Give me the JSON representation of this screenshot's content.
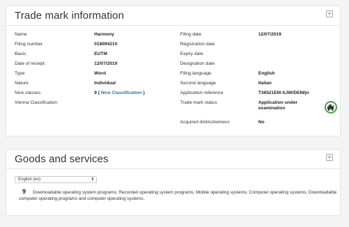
{
  "trade_mark": {
    "title": "Trade mark information",
    "expand_glyph": "+",
    "left_fields": [
      {
        "label": "Name",
        "value": "Harmony"
      },
      {
        "label": "Filing number",
        "value": "018094210"
      },
      {
        "label": "Basis",
        "value": "EUTM"
      },
      {
        "label": "Date of receipt",
        "value": "12/07/2019"
      },
      {
        "label": "Type",
        "value": "Word"
      },
      {
        "label": "Nature",
        "value": "Individual"
      },
      {
        "label": "Nice classes",
        "value_prefix": "9 ( ",
        "value_link": "Nice Classification",
        "value_suffix": " )"
      },
      {
        "label": "Vienna Classification",
        "value": ""
      }
    ],
    "right_fields": [
      {
        "label": "Filing date",
        "value": "12/07/2019"
      },
      {
        "label": "Registration date",
        "value": ""
      },
      {
        "label": "Expiry date",
        "value": ""
      },
      {
        "label": "Designation date",
        "value": ""
      },
      {
        "label": "Filing language",
        "value": "English"
      },
      {
        "label": "Second language",
        "value": "Italian"
      },
      {
        "label": "Application reference",
        "value": "T36521EM-SJW/DEM/jn"
      },
      {
        "label": "Trade mark status",
        "value": "Application under examination"
      },
      {
        "label": "Acquired distinctiveness",
        "value": "No"
      }
    ],
    "status_icon": "status-progress-icon"
  },
  "goods_services": {
    "title": "Goods and services",
    "expand_glyph": "+",
    "language_select": "English (en)",
    "select_arrow": "⬍",
    "class_number": "9",
    "class_text": "Downloadable operating system programs; Recorded operating system programs; Mobile operating systems; Computer operating systems; Downloadable computer operating programs and computer operating systems."
  }
}
